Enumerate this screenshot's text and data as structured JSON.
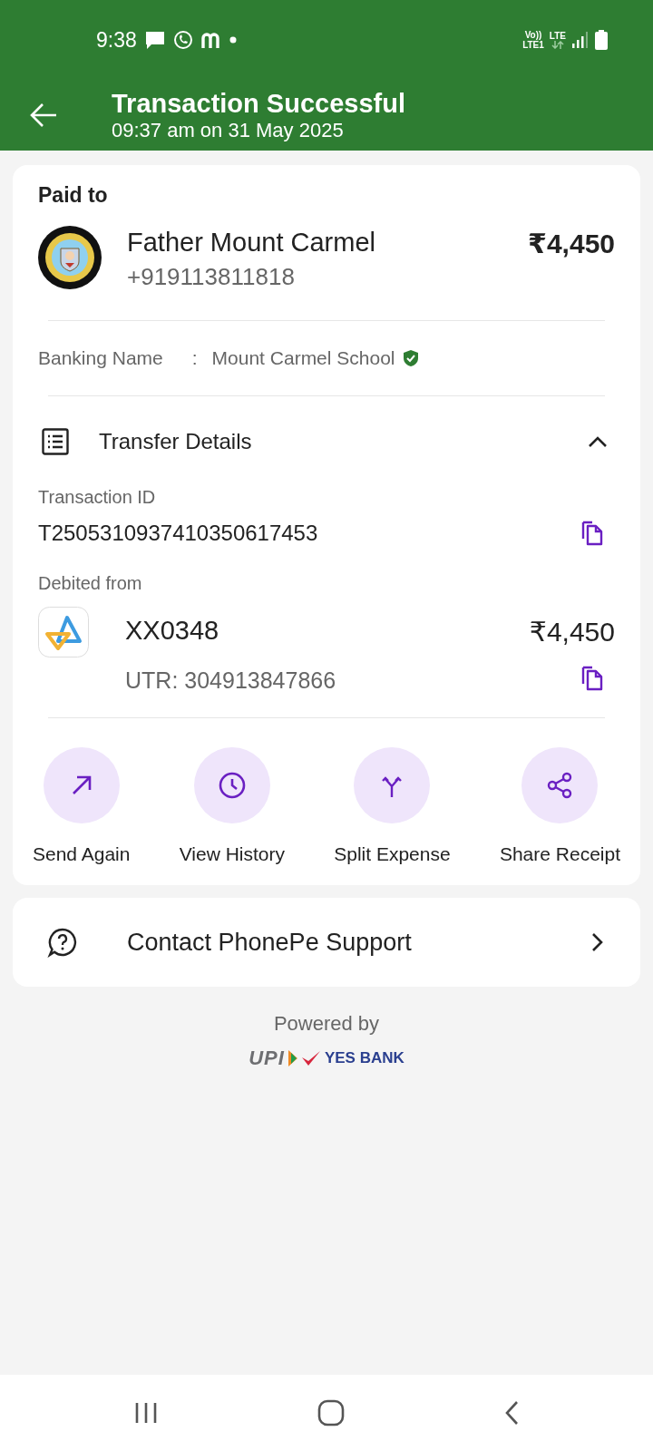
{
  "status_bar": {
    "time": "9:38",
    "network": [
      "Vo))",
      "LTE1",
      "LTE"
    ]
  },
  "header": {
    "title": "Transaction Successful",
    "subtitle": "09:37 am on 31 May 2025"
  },
  "paid_to": {
    "heading": "Paid to",
    "name": "Father Mount Carmel",
    "phone": "+919113811818",
    "amount": "₹4,450",
    "banking_label": "Banking Name",
    "separator": ":",
    "banking_name": "Mount Carmel School",
    "verified": true
  },
  "transfer": {
    "title": "Transfer Details",
    "expanded": true,
    "transaction_id_label": "Transaction ID",
    "transaction_id": "T2505310937410350617453",
    "debited_label": "Debited from",
    "account": "XX0348",
    "debited_amount": "₹4,450",
    "utr": "UTR: 304913847866"
  },
  "actions": [
    {
      "kind": "send",
      "label": "Send Again"
    },
    {
      "kind": "history",
      "label": "View History"
    },
    {
      "kind": "split",
      "label": "Split Expense"
    },
    {
      "kind": "share",
      "label": "Share Receipt"
    }
  ],
  "support": {
    "label": "Contact PhonePe Support"
  },
  "footer": {
    "powered_by": "Powered by",
    "upi": "UPI",
    "bank": "YES BANK"
  }
}
